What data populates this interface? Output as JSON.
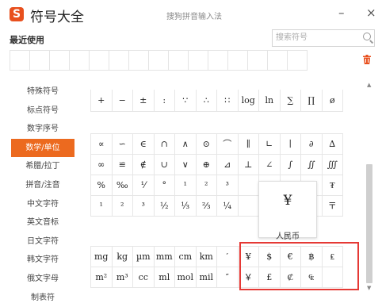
{
  "app": {
    "logo_char": "S",
    "title": "符号大全",
    "ime_name": "搜狗拼音输入法",
    "minimize_glyph": "–",
    "close_glyph": "×"
  },
  "recent": {
    "label": "最近使用",
    "slot_count": 15
  },
  "search": {
    "placeholder": "搜索符号",
    "value": ""
  },
  "sidebar": {
    "items": [
      {
        "label": "特殊符号"
      },
      {
        "label": "标点符号"
      },
      {
        "label": "数字序号"
      },
      {
        "label": "数学/单位",
        "active": true
      },
      {
        "label": "希腊/拉丁"
      },
      {
        "label": "拼音/注音"
      },
      {
        "label": "中文字符"
      },
      {
        "label": "英文音标"
      },
      {
        "label": "日文字符"
      },
      {
        "label": "韩文字符"
      },
      {
        "label": "俄文字母"
      },
      {
        "label": "制表符"
      }
    ]
  },
  "symbols": {
    "row1": [
      "+",
      "−",
      "±",
      ":",
      "∵",
      "∴",
      "∷",
      "log",
      "ln",
      "∑",
      "∏",
      "ø"
    ],
    "row2": [
      "∝",
      "∽",
      "∈",
      "∩",
      "∧",
      "⊙",
      "⌒",
      "∥",
      "∟",
      "∣",
      "∂",
      "∆"
    ],
    "row3": [
      "∞",
      "≌",
      "∉",
      "∪",
      "∨",
      "⊕",
      "⊿",
      "⊥",
      "∠",
      "∫",
      "∬",
      "∭"
    ],
    "row4": [
      "%",
      "‰",
      "⅟",
      "°",
      "¹",
      "²",
      "³",
      "",
      "",
      "",
      "¢",
      "₮"
    ],
    "row5": [
      "¹",
      "²",
      "³",
      "½",
      "⅓",
      "⅔",
      "¼",
      "",
      "",
      "",
      "℉",
      "〒"
    ],
    "row6": [
      "mg",
      "kg",
      "µm",
      "mm",
      "cm",
      "km",
      "′",
      "¥",
      "$",
      "€",
      "฿",
      "₤"
    ],
    "row7": [
      "m²",
      "m³",
      "cc",
      "ml",
      "mol",
      "mil",
      "″",
      "￥",
      "£",
      "₡",
      "₠",
      ""
    ]
  },
  "tooltip": {
    "symbol": "¥",
    "name": "人民币"
  },
  "colors": {
    "accent": "#ec6a1f",
    "highlight_border": "#e53935",
    "logo": "#e8501e"
  },
  "icons": {
    "logo": "sogou-logo-icon",
    "search": "search-icon",
    "trash": "trash-icon"
  }
}
